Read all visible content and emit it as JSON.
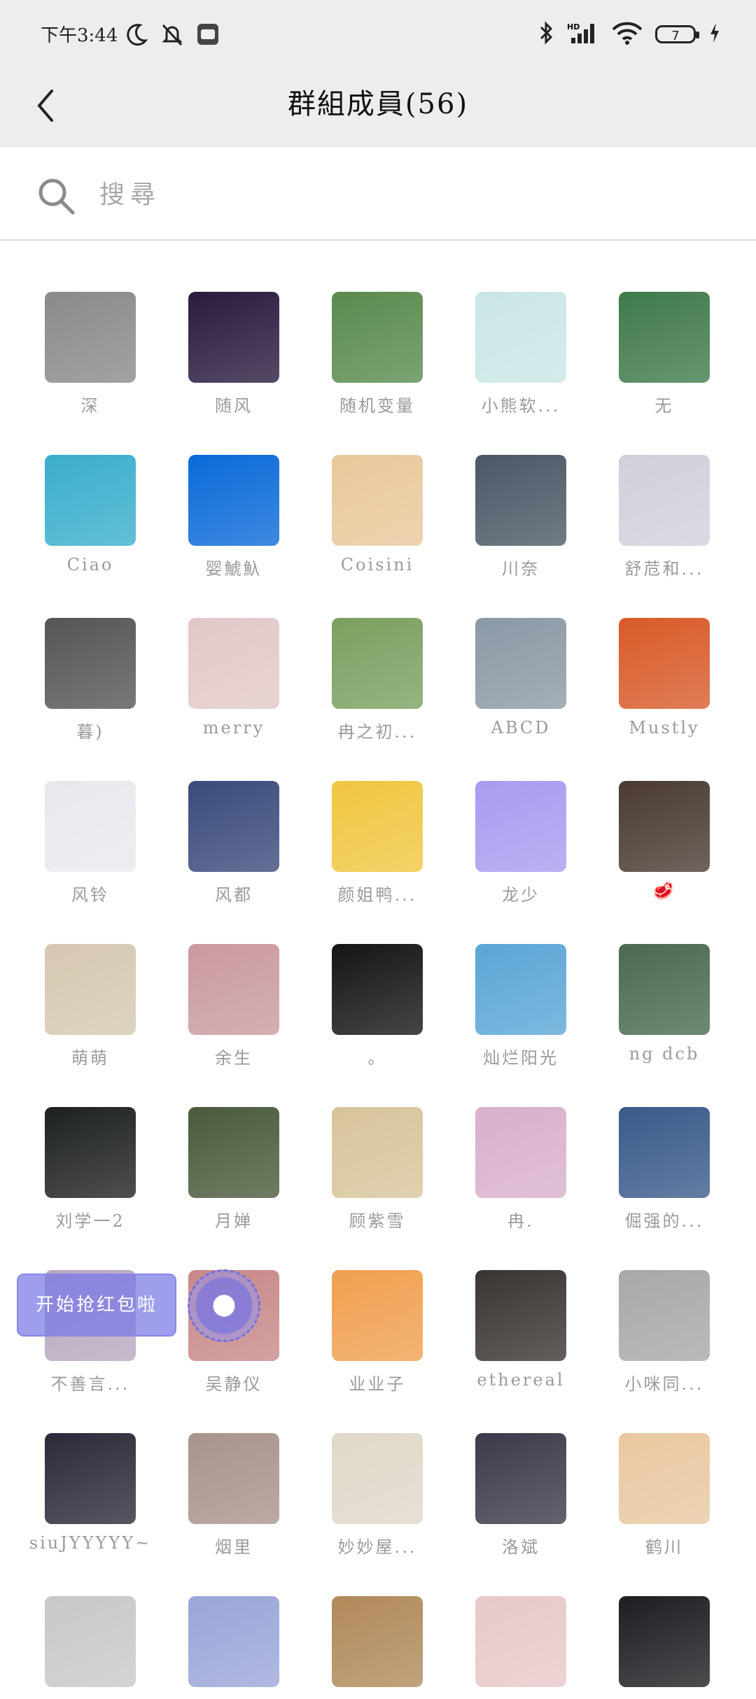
{
  "status_bar": {
    "time": "下午3:44",
    "battery": "7"
  },
  "header": {
    "title": "群組成員(56)"
  },
  "search": {
    "placeholder": "搜尋"
  },
  "floating_banner": {
    "text": "开始抢红包啦"
  },
  "colors": {
    "header_bg": "#ededed",
    "name_gray": "#9a9a9a",
    "accent_purple": "#8a86e6"
  },
  "members": [
    {
      "name": "深",
      "color": "#8a8a8a"
    },
    {
      "name": "随风",
      "color": "#2a1a3e"
    },
    {
      "name": "随机变量",
      "color": "#5a8a4e"
    },
    {
      "name": "小熊软...",
      "color": "#c9e6e6"
    },
    {
      "name": "无",
      "color": "#3f7a4a"
    },
    {
      "name": "Ciao",
      "color": "#3aaecc"
    },
    {
      "name": "婴鯱魞",
      "color": "#0a6ad8"
    },
    {
      "name": "Coisini",
      "color": "#e8c89a"
    },
    {
      "name": "川奈",
      "color": "#4a5866"
    },
    {
      "name": "舒苊和...",
      "color": "#d0d0da"
    },
    {
      "name": "暮)",
      "color": "#555555"
    },
    {
      "name": "merry",
      "color": "#e2c8c8"
    },
    {
      "name": "冉之初...",
      "color": "#7aa060"
    },
    {
      "name": "ABCD",
      "color": "#8a99a6"
    },
    {
      "name": "Mustly",
      "color": "#d85a28"
    },
    {
      "name": "风铃",
      "color": "#e8e8ee"
    },
    {
      "name": "风都",
      "color": "#3a4a7a"
    },
    {
      "name": "颜姐鸭...",
      "color": "#f0c640"
    },
    {
      "name": "龙少",
      "color": "#a79cf0"
    },
    {
      "name": "🥩",
      "color": "#4a3a32"
    },
    {
      "name": "萌萌",
      "color": "#d6c8b0"
    },
    {
      "name": "余生",
      "color": "#c99aa0"
    },
    {
      "name": "。",
      "color": "#151515"
    },
    {
      "name": "灿烂阳光",
      "color": "#5aa6d6"
    },
    {
      "name": "ng dcb",
      "color": "#4a6a50"
    },
    {
      "name": "刘学一2",
      "color": "#1e221e"
    },
    {
      "name": "月婵",
      "color": "#4a5a3a"
    },
    {
      "name": "顾紫雪",
      "color": "#d8c49a"
    },
    {
      "name": "冉.",
      "color": "#d8b0cc"
    },
    {
      "name": "倔强的...",
      "color": "#3a5a8a"
    },
    {
      "name": "不善言...",
      "color": "#b8a8c0"
    },
    {
      "name": "吴静仪",
      "color": "#c88888"
    },
    {
      "name": "业业子",
      "color": "#f0a050"
    },
    {
      "name": "ethereal",
      "color": "#3a3432"
    },
    {
      "name": "小咪同...",
      "color": "#a8a8a8"
    },
    {
      "name": "siuJYYYYY~",
      "color": "#2a2a3a"
    },
    {
      "name": "烟里",
      "color": "#a8948a"
    },
    {
      "name": "妙妙屋...",
      "color": "#e0d8c8"
    },
    {
      "name": "洛斌",
      "color": "#3a3a4a"
    },
    {
      "name": "鹤川",
      "color": "#e8c8a0"
    },
    {
      "name": "",
      "color": "#c8c8c8"
    },
    {
      "name": "",
      "color": "#9aa6d8"
    },
    {
      "name": "",
      "color": "#b08a5a"
    },
    {
      "name": "",
      "color": "#e8c8c8"
    },
    {
      "name": "",
      "color": "#1e1e22"
    }
  ]
}
